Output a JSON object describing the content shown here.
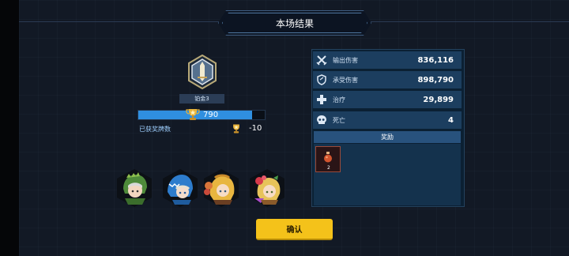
{
  "title": "本场结果",
  "player": {
    "rank_label": "铂金3",
    "rank_progress": 0.9,
    "points": "790",
    "earned_label": "已获奖牌数",
    "medal_delta": "-10"
  },
  "heroes": [
    {
      "name": "green-dino-hood-hero-portrait"
    },
    {
      "name": "blue-shark-hood-hero-portrait"
    },
    {
      "name": "blonde-hero-portrait"
    },
    {
      "name": "flower-girl-hero-portrait"
    }
  ],
  "stats": [
    {
      "icon": "crossed-swords-icon",
      "label": "输出伤害",
      "value": "836,116"
    },
    {
      "icon": "shield-icon",
      "label": "承受伤害",
      "value": "898,790"
    },
    {
      "icon": "plus-heal-icon",
      "label": "治疗",
      "value": "29,899"
    },
    {
      "icon": "skull-icon",
      "label": "死亡",
      "value": "4"
    }
  ],
  "rewards": {
    "header": "奖励",
    "items": [
      {
        "icon": "potion-bottle-icon",
        "count": "2"
      }
    ]
  },
  "confirm_label": "确认",
  "colors": {
    "accent_blue": "#2f8fe0",
    "button_yellow": "#f4c21a",
    "panel_bg": "#0b2033",
    "row_bg": "#1c3e5f"
  }
}
